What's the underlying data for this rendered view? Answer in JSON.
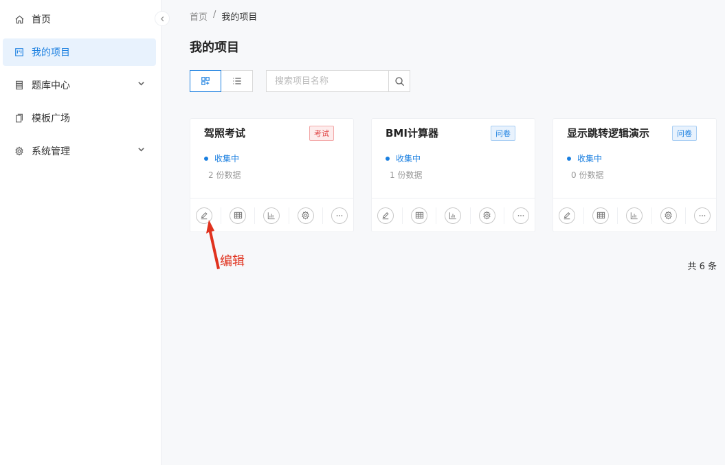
{
  "sidebar": {
    "items": [
      {
        "label": "首页",
        "icon": "home-icon"
      },
      {
        "label": "我的项目",
        "icon": "project-icon",
        "active": true
      },
      {
        "label": "题库中心",
        "icon": "question-bank-icon",
        "expandable": true
      },
      {
        "label": "模板广场",
        "icon": "template-icon"
      },
      {
        "label": "系统管理",
        "icon": "gear-icon",
        "expandable": true
      }
    ]
  },
  "breadcrumb": {
    "home": "首页",
    "separator": "/",
    "current": "我的项目"
  },
  "page": {
    "title": "我的项目"
  },
  "toolbar": {
    "view_grid_icon": "grid-view-icon",
    "view_list_icon": "list-view-icon",
    "search_placeholder": "搜索项目名称"
  },
  "cards": [
    {
      "title": "驾照考试",
      "tag": "考试",
      "tag_color": "#e04848",
      "status": "收集中",
      "count": "2 份数据"
    },
    {
      "title": "BMI计算器",
      "tag": "问卷",
      "tag_color": "#1a7fe0",
      "status": "收集中",
      "count": "1 份数据"
    },
    {
      "title": "显示跳转逻辑演示",
      "tag": "问卷",
      "tag_color": "#1a7fe0",
      "status": "收集中",
      "count": "0 份数据"
    }
  ],
  "card_actions": [
    "edit-icon",
    "table-icon",
    "chart-icon",
    "gear-icon",
    "more-icon"
  ],
  "annotation": {
    "label": "编辑",
    "color": "#e0321e"
  },
  "pagination": {
    "total": "共 6 条"
  },
  "colors": {
    "accent": "#1a7fe0",
    "exam_tag": "#e04848"
  }
}
